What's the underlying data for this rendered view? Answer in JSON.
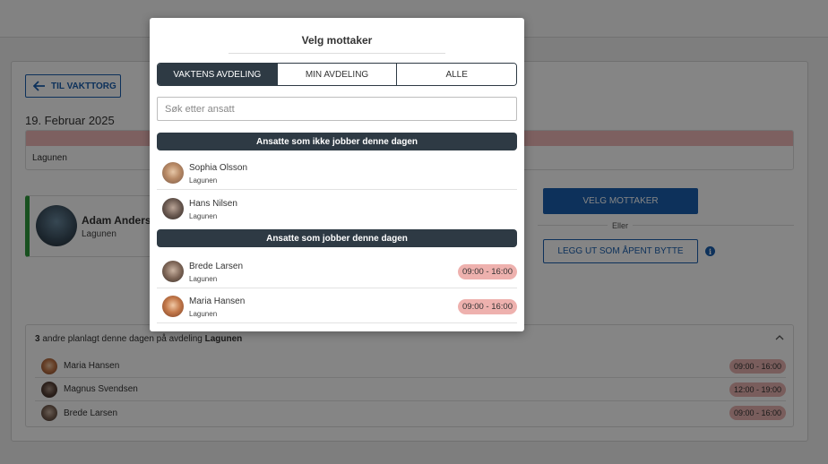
{
  "background": {
    "back_button": "TIL VAKTTORG",
    "date": "19. Februar 2025",
    "department": "Lagunen",
    "person": {
      "name": "Adam Anders",
      "department": "Lagunen"
    },
    "select_recipient_button": "VELG MOTTAKER",
    "or_text": "Eller",
    "publish_button": "LEGG UT SOM ÅPENT BYTTE",
    "others": {
      "count": "3",
      "header_text": " andre planlagt denne dagen på avdeling ",
      "department": "Lagunen",
      "rows": [
        {
          "name": "Maria Hansen",
          "time": "09:00 - 16:00"
        },
        {
          "name": "Magnus Svendsen",
          "time": "12:00 - 19:00"
        },
        {
          "name": "Brede Larsen",
          "time": "09:00 - 16:00"
        }
      ]
    }
  },
  "modal": {
    "title": "Velg mottaker",
    "tabs": [
      {
        "label": "VAKTENS AVDELING",
        "active": true
      },
      {
        "label": "MIN AVDELING",
        "active": false
      },
      {
        "label": "ALLE",
        "active": false
      }
    ],
    "search_placeholder": "Søk etter ansatt",
    "section_not_working": "Ansatte som ikke jobber denne dagen",
    "not_working": [
      {
        "name": "Sophia Olsson",
        "department": "Lagunen"
      },
      {
        "name": "Hans Nilsen",
        "department": "Lagunen"
      }
    ],
    "section_working": "Ansatte som jobber denne dagen",
    "working": [
      {
        "name": "Brede Larsen",
        "department": "Lagunen",
        "time": "09:00 - 16:00"
      },
      {
        "name": "Maria Hansen",
        "department": "Lagunen",
        "time": "09:00 - 16:00"
      }
    ]
  },
  "colors": {
    "primary": "#1a5fae",
    "dark": "#2e3a44",
    "time_badge": "#eeb1ae",
    "active_border": "#2e9a3c"
  }
}
